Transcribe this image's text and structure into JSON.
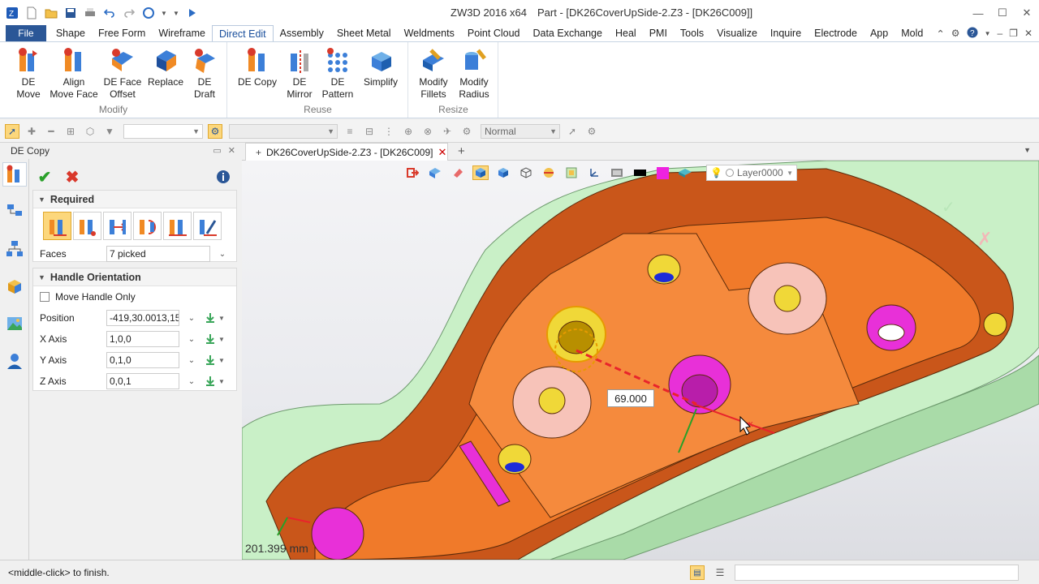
{
  "window": {
    "app_title": "ZW3D 2016  x64",
    "doc_title": "Part - [DK26CoverUpSide-2.Z3 - [DK26C009]]"
  },
  "menu": {
    "file": "File",
    "items": [
      "Shape",
      "Free Form",
      "Wireframe",
      "Direct Edit",
      "Assembly",
      "Sheet Metal",
      "Weldments",
      "Point Cloud",
      "Data Exchange",
      "Heal",
      "PMI",
      "Tools",
      "Visualize",
      "Inquire",
      "Electrode",
      "App",
      "Mold"
    ],
    "active": "Direct Edit"
  },
  "ribbon": {
    "groups": [
      {
        "label": "Modify",
        "buttons": [
          [
            "DE",
            "Move"
          ],
          [
            "Align",
            "Move Face"
          ],
          [
            "DE Face",
            "Offset"
          ],
          [
            "Replace",
            ""
          ],
          [
            "DE",
            "Draft"
          ]
        ]
      },
      {
        "label": "Reuse",
        "buttons": [
          [
            "DE Copy",
            ""
          ],
          [
            "DE",
            "Mirror"
          ],
          [
            "DE",
            "Pattern"
          ],
          [
            "Simplify",
            ""
          ]
        ]
      },
      {
        "label": "Resize",
        "buttons": [
          [
            "Modify",
            "Fillets"
          ],
          [
            "Modify",
            "Radius"
          ]
        ]
      }
    ]
  },
  "subtoolbar": {
    "style_combo": "Normal"
  },
  "panel": {
    "title": "DE Copy",
    "required_title": "Required",
    "faces_label": "Faces",
    "faces_value": "7 picked",
    "handle_title": "Handle Orientation",
    "move_handle_only": "Move Handle Only",
    "position_label": "Position",
    "position_value": "-419,30.0013,15",
    "x_axis_label": "X Axis",
    "x_axis_value": "1,0,0",
    "y_axis_label": "Y Axis",
    "y_axis_value": "0,1,0",
    "z_axis_label": "Z Axis",
    "z_axis_value": "0,0,1"
  },
  "viewport": {
    "tab_label": "DK26CoverUpSide-2.Z3 - [DK26C009]",
    "layer": "Layer0000",
    "dimension": "69.000",
    "bottom_dimension": "201.399 mm"
  },
  "status": {
    "prompt": "<middle-click> to finish."
  },
  "colors": {
    "accent": "#2b5797",
    "part_orange": "#f07a2a",
    "part_green": "#c9f0c7",
    "hole_magenta": "#e830d8"
  }
}
